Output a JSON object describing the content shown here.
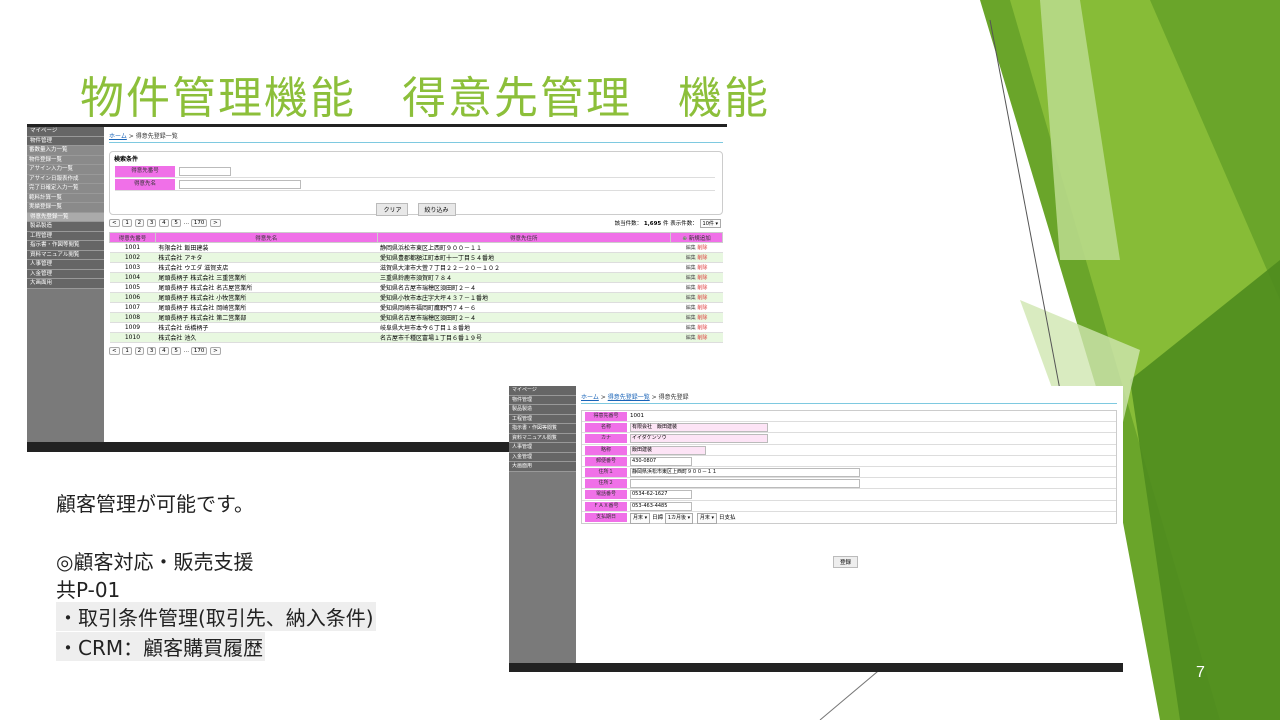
{
  "slide": {
    "title": "物件管理機能　得意先管理　機能",
    "page_number": "7",
    "accent_color": "#8cbf3a"
  },
  "notes": [
    "顧客管理が可能です。",
    "◎顧客対応・販売支援",
    "共P-01",
    "・取引条件管理(取引先、納入条件)",
    "・CRM：顧客購買履歴"
  ],
  "list_screen": {
    "sidebar": [
      {
        "label": "マイページ",
        "type": "main"
      },
      {
        "label": "物件管理",
        "type": "main"
      },
      {
        "label": "番数量入力一覧",
        "type": "sub"
      },
      {
        "label": "物件登録一覧",
        "type": "sub"
      },
      {
        "label": "アサイン入力一覧",
        "type": "sub"
      },
      {
        "label": "アサイン日報表作成",
        "type": "sub"
      },
      {
        "label": "完了日確定入力一覧",
        "type": "sub"
      },
      {
        "label": "範料計算一覧",
        "type": "sub"
      },
      {
        "label": "実績登録一覧",
        "type": "sub"
      },
      {
        "label": "得意先登録一覧",
        "type": "active"
      },
      {
        "label": "製品製造",
        "type": "main"
      },
      {
        "label": "工程管理",
        "type": "main"
      },
      {
        "label": "指示書・作図等閲覧",
        "type": "main"
      },
      {
        "label": "資料マニュアル閲覧",
        "type": "main"
      },
      {
        "label": "人事管理",
        "type": "main"
      },
      {
        "label": "入金管理",
        "type": "main"
      },
      {
        "label": "大画面用",
        "type": "main"
      }
    ],
    "breadcrumb": {
      "home": "ホーム",
      "sep": ">",
      "current": "得意先登録一覧"
    },
    "search": {
      "heading": "検索条件",
      "field1_label": "得意先番号",
      "field2_label": "得意先名",
      "clear_button": "クリア",
      "filter_button": "絞り込み"
    },
    "pager": {
      "prev": "<",
      "pages": [
        "1",
        "2",
        "3",
        "4",
        "5"
      ],
      "ellipsis": "…",
      "last": "170",
      "next": ">",
      "count_text": "該当件数：",
      "count_value": "1,695",
      "count_unit": "件",
      "per_page_label": "表示件数：",
      "per_page_value": "10件 ▾"
    },
    "columns": [
      "得意先番号",
      "得意先名",
      "得意先住所"
    ],
    "new_button": "新規追加",
    "edit_label": "編集",
    "delete_label": "削除",
    "rows": [
      [
        "1001",
        "有限会社 飯田建装",
        "静岡県浜松市東区上西町９００－１１"
      ],
      [
        "1002",
        "株式会社 アキタ",
        "愛知県豊郡都額江町本町十一丁目５４番地"
      ],
      [
        "1003",
        "株式会社 ウエダ 滋賀支店",
        "滋賀県大津市大萱７丁目２２－２０－１０２"
      ],
      [
        "1004",
        "尾頭長柄子 株式会社 三重営業所",
        "三重県鈴鹿市須賀町７８４"
      ],
      [
        "1005",
        "尾頭長柄子 株式会社 名古屋営業所",
        "愛知県名古屋市瑞穂区須田町２－４"
      ],
      [
        "1006",
        "尾頭長柄子 株式会社 小牧営業所",
        "愛知県小牧市本庄字大坪４３７－１番地"
      ],
      [
        "1007",
        "尾頭長柄子 株式会社 岡崎営業所",
        "愛知県岡崎市福岡町鷹野門７４－６"
      ],
      [
        "1008",
        "尾頭長柄子 株式会社 第二営業部",
        "愛知県名古屋市瑞穂区須田町２－４"
      ],
      [
        "1009",
        "株式会社 岳橋柄子",
        "岐阜県大垣市本今６丁目１８番地"
      ],
      [
        "1010",
        "株式会社 池久",
        "名古屋市千種区富場１丁目６番１９号"
      ]
    ]
  },
  "detail_screen": {
    "sidebar": [
      "マイページ",
      "物件管理",
      "製品製造",
      "工程管理",
      "指示書・作図等閲覧",
      "資料マニュアル閲覧",
      "人事管理",
      "入金管理",
      "大画面用"
    ],
    "breadcrumb": {
      "home": "ホーム",
      "sep": ">",
      "list": "得意先登録一覧",
      "current": "得意先登録"
    },
    "fields": [
      {
        "label": "得意先番号",
        "value": "1001",
        "kind": "text"
      },
      {
        "label": "名称",
        "value": "有限会社　飯田建装",
        "kind": "pink"
      },
      {
        "label": "カナ",
        "value": "イイダケンソウ",
        "kind": "pink"
      },
      {
        "label": "略称",
        "value": "飯田建装",
        "kind": "pinkshort"
      },
      {
        "label": "郵便番号",
        "value": "430-0807",
        "kind": "short"
      },
      {
        "label": "住所１",
        "value": "静岡県浜松市東区上西町９００－１１",
        "kind": "long"
      },
      {
        "label": "住所２",
        "value": "",
        "kind": "long"
      },
      {
        "label": "電話番号",
        "value": "0534-62-1627",
        "kind": "short"
      },
      {
        "label": "ＦＡＸ番号",
        "value": "053-463-4485",
        "kind": "short"
      }
    ],
    "payment": {
      "label": "支払期日",
      "sel1": "月末 ▾",
      "t1": "日締",
      "sel2": "1カ月後 ▾",
      "sel3": "月末 ▾",
      "t2": "日支払"
    },
    "register_button": "登録"
  }
}
